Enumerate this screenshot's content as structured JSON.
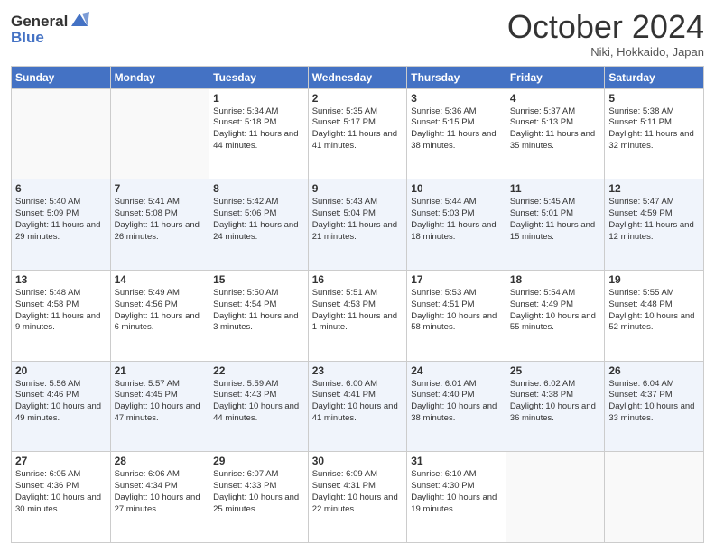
{
  "logo": {
    "line1": "General",
    "line2": "Blue"
  },
  "title": "October 2024",
  "location": "Niki, Hokkaido, Japan",
  "weekdays": [
    "Sunday",
    "Monday",
    "Tuesday",
    "Wednesday",
    "Thursday",
    "Friday",
    "Saturday"
  ],
  "weeks": [
    [
      {
        "day": "",
        "sunrise": "",
        "sunset": "",
        "daylight": ""
      },
      {
        "day": "",
        "sunrise": "",
        "sunset": "",
        "daylight": ""
      },
      {
        "day": "1",
        "sunrise": "Sunrise: 5:34 AM",
        "sunset": "Sunset: 5:18 PM",
        "daylight": "Daylight: 11 hours and 44 minutes."
      },
      {
        "day": "2",
        "sunrise": "Sunrise: 5:35 AM",
        "sunset": "Sunset: 5:17 PM",
        "daylight": "Daylight: 11 hours and 41 minutes."
      },
      {
        "day": "3",
        "sunrise": "Sunrise: 5:36 AM",
        "sunset": "Sunset: 5:15 PM",
        "daylight": "Daylight: 11 hours and 38 minutes."
      },
      {
        "day": "4",
        "sunrise": "Sunrise: 5:37 AM",
        "sunset": "Sunset: 5:13 PM",
        "daylight": "Daylight: 11 hours and 35 minutes."
      },
      {
        "day": "5",
        "sunrise": "Sunrise: 5:38 AM",
        "sunset": "Sunset: 5:11 PM",
        "daylight": "Daylight: 11 hours and 32 minutes."
      }
    ],
    [
      {
        "day": "6",
        "sunrise": "Sunrise: 5:40 AM",
        "sunset": "Sunset: 5:09 PM",
        "daylight": "Daylight: 11 hours and 29 minutes."
      },
      {
        "day": "7",
        "sunrise": "Sunrise: 5:41 AM",
        "sunset": "Sunset: 5:08 PM",
        "daylight": "Daylight: 11 hours and 26 minutes."
      },
      {
        "day": "8",
        "sunrise": "Sunrise: 5:42 AM",
        "sunset": "Sunset: 5:06 PM",
        "daylight": "Daylight: 11 hours and 24 minutes."
      },
      {
        "day": "9",
        "sunrise": "Sunrise: 5:43 AM",
        "sunset": "Sunset: 5:04 PM",
        "daylight": "Daylight: 11 hours and 21 minutes."
      },
      {
        "day": "10",
        "sunrise": "Sunrise: 5:44 AM",
        "sunset": "Sunset: 5:03 PM",
        "daylight": "Daylight: 11 hours and 18 minutes."
      },
      {
        "day": "11",
        "sunrise": "Sunrise: 5:45 AM",
        "sunset": "Sunset: 5:01 PM",
        "daylight": "Daylight: 11 hours and 15 minutes."
      },
      {
        "day": "12",
        "sunrise": "Sunrise: 5:47 AM",
        "sunset": "Sunset: 4:59 PM",
        "daylight": "Daylight: 11 hours and 12 minutes."
      }
    ],
    [
      {
        "day": "13",
        "sunrise": "Sunrise: 5:48 AM",
        "sunset": "Sunset: 4:58 PM",
        "daylight": "Daylight: 11 hours and 9 minutes."
      },
      {
        "day": "14",
        "sunrise": "Sunrise: 5:49 AM",
        "sunset": "Sunset: 4:56 PM",
        "daylight": "Daylight: 11 hours and 6 minutes."
      },
      {
        "day": "15",
        "sunrise": "Sunrise: 5:50 AM",
        "sunset": "Sunset: 4:54 PM",
        "daylight": "Daylight: 11 hours and 3 minutes."
      },
      {
        "day": "16",
        "sunrise": "Sunrise: 5:51 AM",
        "sunset": "Sunset: 4:53 PM",
        "daylight": "Daylight: 11 hours and 1 minute."
      },
      {
        "day": "17",
        "sunrise": "Sunrise: 5:53 AM",
        "sunset": "Sunset: 4:51 PM",
        "daylight": "Daylight: 10 hours and 58 minutes."
      },
      {
        "day": "18",
        "sunrise": "Sunrise: 5:54 AM",
        "sunset": "Sunset: 4:49 PM",
        "daylight": "Daylight: 10 hours and 55 minutes."
      },
      {
        "day": "19",
        "sunrise": "Sunrise: 5:55 AM",
        "sunset": "Sunset: 4:48 PM",
        "daylight": "Daylight: 10 hours and 52 minutes."
      }
    ],
    [
      {
        "day": "20",
        "sunrise": "Sunrise: 5:56 AM",
        "sunset": "Sunset: 4:46 PM",
        "daylight": "Daylight: 10 hours and 49 minutes."
      },
      {
        "day": "21",
        "sunrise": "Sunrise: 5:57 AM",
        "sunset": "Sunset: 4:45 PM",
        "daylight": "Daylight: 10 hours and 47 minutes."
      },
      {
        "day": "22",
        "sunrise": "Sunrise: 5:59 AM",
        "sunset": "Sunset: 4:43 PM",
        "daylight": "Daylight: 10 hours and 44 minutes."
      },
      {
        "day": "23",
        "sunrise": "Sunrise: 6:00 AM",
        "sunset": "Sunset: 4:41 PM",
        "daylight": "Daylight: 10 hours and 41 minutes."
      },
      {
        "day": "24",
        "sunrise": "Sunrise: 6:01 AM",
        "sunset": "Sunset: 4:40 PM",
        "daylight": "Daylight: 10 hours and 38 minutes."
      },
      {
        "day": "25",
        "sunrise": "Sunrise: 6:02 AM",
        "sunset": "Sunset: 4:38 PM",
        "daylight": "Daylight: 10 hours and 36 minutes."
      },
      {
        "day": "26",
        "sunrise": "Sunrise: 6:04 AM",
        "sunset": "Sunset: 4:37 PM",
        "daylight": "Daylight: 10 hours and 33 minutes."
      }
    ],
    [
      {
        "day": "27",
        "sunrise": "Sunrise: 6:05 AM",
        "sunset": "Sunset: 4:36 PM",
        "daylight": "Daylight: 10 hours and 30 minutes."
      },
      {
        "day": "28",
        "sunrise": "Sunrise: 6:06 AM",
        "sunset": "Sunset: 4:34 PM",
        "daylight": "Daylight: 10 hours and 27 minutes."
      },
      {
        "day": "29",
        "sunrise": "Sunrise: 6:07 AM",
        "sunset": "Sunset: 4:33 PM",
        "daylight": "Daylight: 10 hours and 25 minutes."
      },
      {
        "day": "30",
        "sunrise": "Sunrise: 6:09 AM",
        "sunset": "Sunset: 4:31 PM",
        "daylight": "Daylight: 10 hours and 22 minutes."
      },
      {
        "day": "31",
        "sunrise": "Sunrise: 6:10 AM",
        "sunset": "Sunset: 4:30 PM",
        "daylight": "Daylight: 10 hours and 19 minutes."
      },
      {
        "day": "",
        "sunrise": "",
        "sunset": "",
        "daylight": ""
      },
      {
        "day": "",
        "sunrise": "",
        "sunset": "",
        "daylight": ""
      }
    ]
  ]
}
